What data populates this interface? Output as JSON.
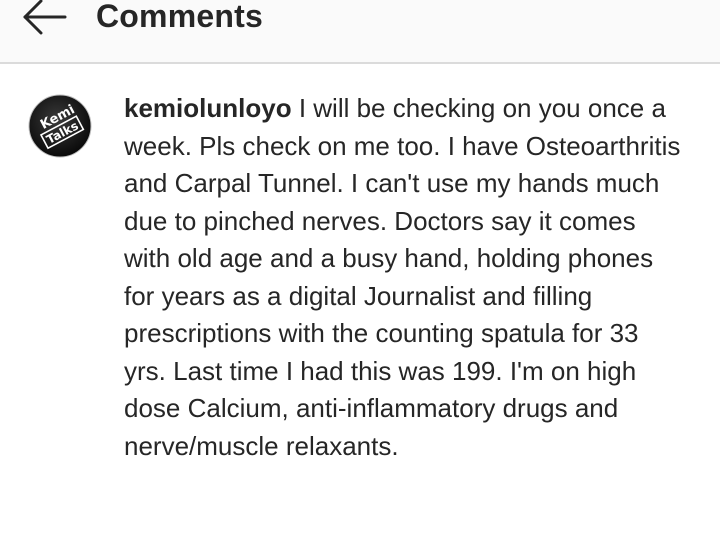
{
  "header": {
    "title": "Comments",
    "back_icon": "arrow-left-icon"
  },
  "comment": {
    "avatar": {
      "icon": "avatar-image",
      "logo_text_line1": "Kemi",
      "logo_text_line2": "Talks"
    },
    "username": "kemiolunloyo",
    "text": "I will be checking on you once a week. Pls check on me too. I have Osteoarthritis and Carpal Tunnel. I can't use my hands much due to pinched nerves. Doctors say it comes with old age and a busy hand, holding phones for years as a digital Journalist and filling prescriptions with the counting spatula for 33 yrs. Last time I had this was 199. I'm on high dose Calcium, anti-inflammatory drugs and nerve/muscle relaxants."
  }
}
